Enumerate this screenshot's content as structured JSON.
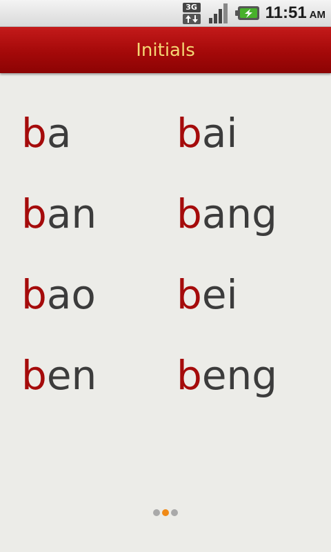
{
  "status_bar": {
    "network_label": "3G",
    "time": "11:51",
    "ampm": "AM",
    "battery_accent": "#47b12b"
  },
  "header": {
    "title": "Initials"
  },
  "syllables": [
    {
      "initial": "b",
      "final": "a"
    },
    {
      "initial": "b",
      "final": "ai"
    },
    {
      "initial": "b",
      "final": "an"
    },
    {
      "initial": "b",
      "final": "ang"
    },
    {
      "initial": "b",
      "final": "ao"
    },
    {
      "initial": "b",
      "final": "ei"
    },
    {
      "initial": "b",
      "final": "en"
    },
    {
      "initial": "b",
      "final": "eng"
    }
  ],
  "pager": {
    "page_count": 3,
    "current_page": 2
  },
  "colors": {
    "title_bar": "#a40909",
    "title_text": "#f4d774",
    "initial": "#a50b0b",
    "final": "#3c3c3c",
    "pager_active": "#f08a17",
    "pager_inactive": "#a9a9a9"
  }
}
